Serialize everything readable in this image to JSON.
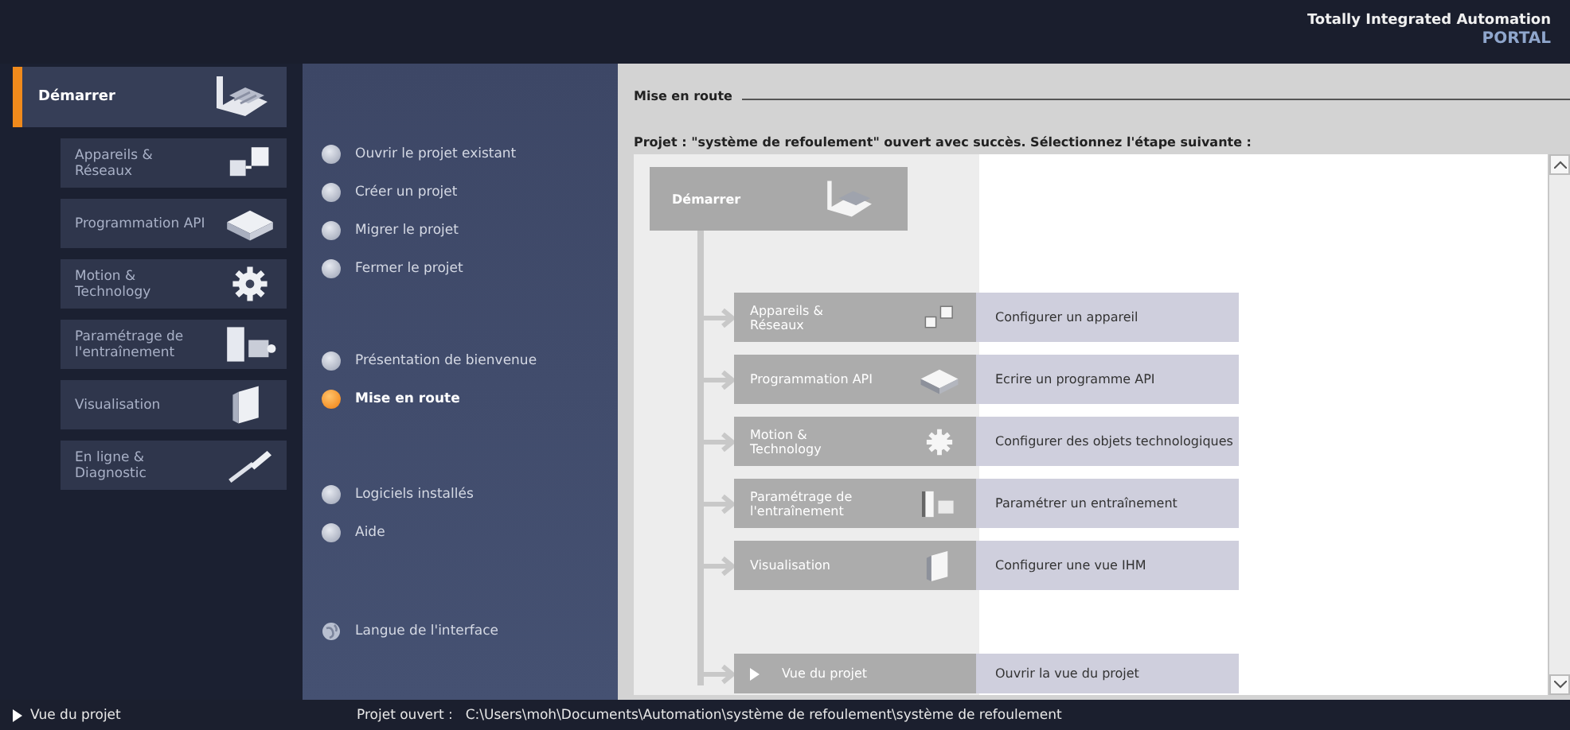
{
  "brand": {
    "line_1": "Totally Integrated Automation",
    "line_2": "PORTAL"
  },
  "sidebar": {
    "header": {
      "label": "Démarrer",
      "selected": true
    },
    "items": [
      {
        "label": "Appareils & Réseaux",
        "kind": "devices",
        "selected": false
      },
      {
        "label": "Programmation API",
        "kind": "program",
        "selected": false
      },
      {
        "label": "Motion & Technology",
        "kind": "gear",
        "selected": false
      },
      {
        "label": "Paramétrage de l'entraînement",
        "kind": "drive",
        "selected": false
      },
      {
        "label": "Visualisation",
        "kind": "screen",
        "selected": false
      },
      {
        "label": "En ligne & Diagnostic",
        "kind": "tool",
        "selected": false
      }
    ]
  },
  "actions": [
    [
      {
        "label": "Ouvrir le projet existant",
        "kind": "bullet",
        "selected": false
      },
      {
        "label": "Créer un projet",
        "kind": "bullet",
        "selected": false
      },
      {
        "label": "Migrer le projet",
        "kind": "bullet",
        "selected": false
      },
      {
        "label": "Fermer le projet",
        "kind": "bullet",
        "selected": false
      }
    ],
    [
      {
        "label": "Présentation de bienvenue",
        "kind": "bullet",
        "selected": false
      },
      {
        "label": "Mise en route",
        "kind": "bullet",
        "selected": true
      }
    ],
    [
      {
        "label": "Logiciels installés",
        "kind": "bullet",
        "selected": false
      },
      {
        "label": "Aide",
        "kind": "bullet",
        "selected": false
      }
    ],
    [
      {
        "label": "Langue de l'interface",
        "kind": "globe",
        "selected": false
      }
    ]
  ],
  "content": {
    "title": "Mise en route",
    "message": "Projet : \"système de refoulement\" ouvert avec succès. Sélectionnez l'étape suivante :",
    "start_block": {
      "label": "Démarrer"
    },
    "steps": [
      {
        "label": "Appareils & Réseaux",
        "kind": "devices",
        "action": "Configurer un appareil"
      },
      {
        "label": "Programmation API",
        "kind": "program",
        "action": "Ecrire un programme API"
      },
      {
        "label": "Motion & Technology",
        "kind": "gear",
        "action": "Configurer des objets technologiques"
      },
      {
        "label": "Paramétrage de l'entraînement",
        "kind": "drive",
        "action": "Paramétrer un entraînement"
      },
      {
        "label": "Visualisation",
        "kind": "screen",
        "action": "Configurer une vue IHM"
      }
    ],
    "project_step": {
      "label": "Vue du projet",
      "action": "Ouvrir la vue du projet"
    }
  },
  "status_bar": {
    "view_link": "Vue du projet",
    "path_label": "Projet ouvert :",
    "path": "C:\\Users\\moh\\Documents\\Automation\\système de refoulement\\système de refoulement"
  }
}
